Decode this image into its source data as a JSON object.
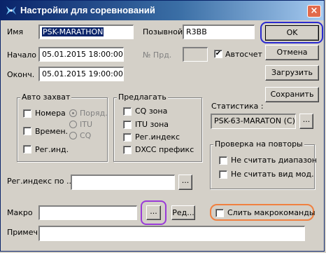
{
  "window": {
    "title": "Настройки для соревнований"
  },
  "fields": {
    "name_label": "Имя",
    "name_value": "PSK-MARATHON",
    "callsign_label": "Позывной",
    "callsign_value": "R3BB",
    "start_label": "Начало",
    "start_value": "05.01.2015 18:00:00",
    "end_label": "Оконч.",
    "end_value": "05.01.2015 19:00:00",
    "prd_label": "№ Прд.",
    "prd_value": "",
    "autocount_label": "Автосчет",
    "autocount_checked": "✔"
  },
  "buttons": {
    "ok": "OK",
    "cancel": "Отмена",
    "load": "Загрузить",
    "save": "Сохранить",
    "edit": "Ред...",
    "browse": "..."
  },
  "auto_capture": {
    "title": "Авто захват",
    "numbers": "Номера",
    "times": "Времен.",
    "reg_index": "Рег.инд.",
    "radio_order": "Поряд.",
    "radio_itu": "ITU",
    "radio_cq": "CQ"
  },
  "suggest": {
    "title": "Предлагать",
    "cq_zone": "CQ зона",
    "itu_zone": "ITU зона",
    "reg_index": "Рег.индекс",
    "dxcc_prefix": "DXCC префикс"
  },
  "statistics": {
    "label": "Статистика :",
    "value": "PSK-63-MARATON (C)"
  },
  "dup_check": {
    "title": "Проверка на повторы",
    "ignore_band": "Не считать диапазон",
    "ignore_mode": "Не считать вид мод."
  },
  "reg_index_by": {
    "label": "Рег.индекс по ...",
    "value": ""
  },
  "macro": {
    "label": "Макро",
    "value": "",
    "merge_label": "Слить макрокоманды"
  },
  "note": {
    "label": "Примеч.",
    "value": ""
  }
}
